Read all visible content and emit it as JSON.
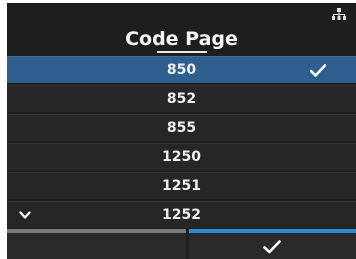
{
  "header": {
    "title": "Code Page",
    "status_icon": "network-icon"
  },
  "list": {
    "selected_index": 0,
    "items": [
      {
        "label": "850",
        "checked": true
      },
      {
        "label": "852",
        "checked": false
      },
      {
        "label": "855",
        "checked": false
      },
      {
        "label": "1250",
        "checked": false
      },
      {
        "label": "1251",
        "checked": false
      },
      {
        "label": "1252",
        "checked": false
      }
    ],
    "more_indicator_icon": "chevron-down-icon"
  },
  "softkeys": {
    "left_icon": "",
    "right_icon": "check-icon"
  },
  "colors": {
    "background": "#1e1e1e",
    "selected_row": "#2f5f8f",
    "softkey_left_bar": "#7a7a7a",
    "softkey_right_bar": "#2a8cd6",
    "text": "#f0f0f0"
  }
}
